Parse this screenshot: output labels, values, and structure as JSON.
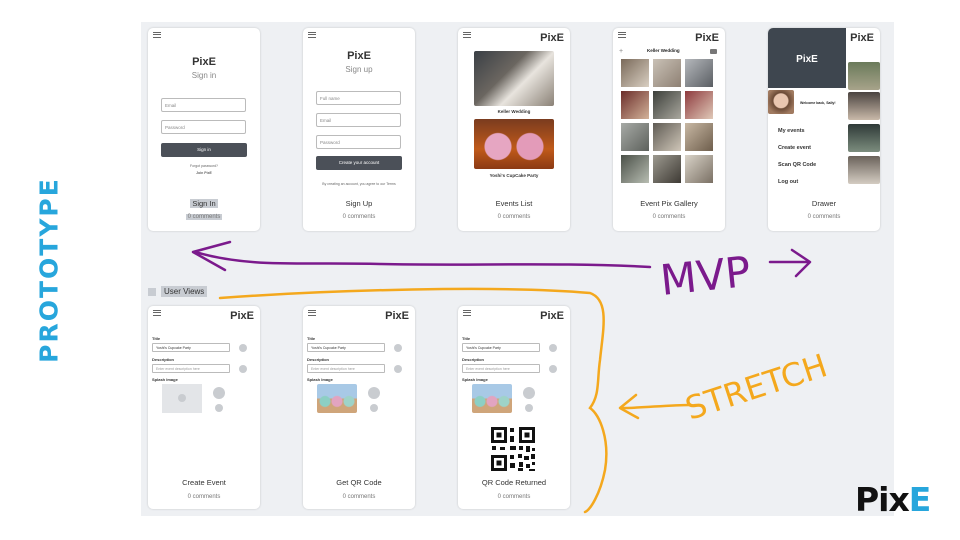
{
  "side_title": "PROTOTYPE",
  "brand": {
    "part1": "Pix",
    "part2": "E"
  },
  "annotations": {
    "mvp": "MVP",
    "stretch": "STRETCH"
  },
  "section_label": "User Views",
  "app_name": "PixE",
  "screens_row1": [
    {
      "label": "Sign In",
      "comments": "0 comments"
    },
    {
      "label": "Sign Up",
      "comments": "0 comments"
    },
    {
      "label": "Events List",
      "comments": "0 comments"
    },
    {
      "label": "Event Pix Gallery",
      "comments": "0 comments"
    },
    {
      "label": "Drawer",
      "comments": "0 comments"
    }
  ],
  "screens_row2": [
    {
      "label": "Create Event",
      "comments": "0 comments"
    },
    {
      "label": "Get QR Code",
      "comments": "0 comments"
    },
    {
      "label": "QR Code Returned",
      "comments": "0 comments"
    }
  ],
  "signin": {
    "subtitle": "Sign in",
    "email_placeholder": "Email",
    "password_placeholder": "Password",
    "button": "Sign in",
    "forgot": "Forgot password?",
    "join": "Join PixE"
  },
  "signup": {
    "subtitle": "Sign up",
    "fullname_placeholder": "Full name",
    "email_placeholder": "Email",
    "password_placeholder": "Password",
    "button": "Create your account",
    "terms": "By creating an account, you agree to our Terms"
  },
  "events": {
    "event1": "Keller Wedding",
    "event2": "Yoshi's CupCake Party"
  },
  "gallery": {
    "title": "Keller Wedding"
  },
  "drawer": {
    "welcome": "Welcome back, Sally!",
    "items": [
      "My events",
      "Create event",
      "Scan QR Code",
      "Log out"
    ]
  },
  "form": {
    "title_label": "Title",
    "title_value": "Yoshi's Cupcake Party",
    "desc_label": "Description",
    "desc_placeholder": "Enter event description here",
    "splash_label": "Splash Image"
  },
  "colors": {
    "accent": "#27a6dc",
    "mvp": "#7b1a8c",
    "stretch": "#f4a81d",
    "board": "#eef0f3"
  }
}
